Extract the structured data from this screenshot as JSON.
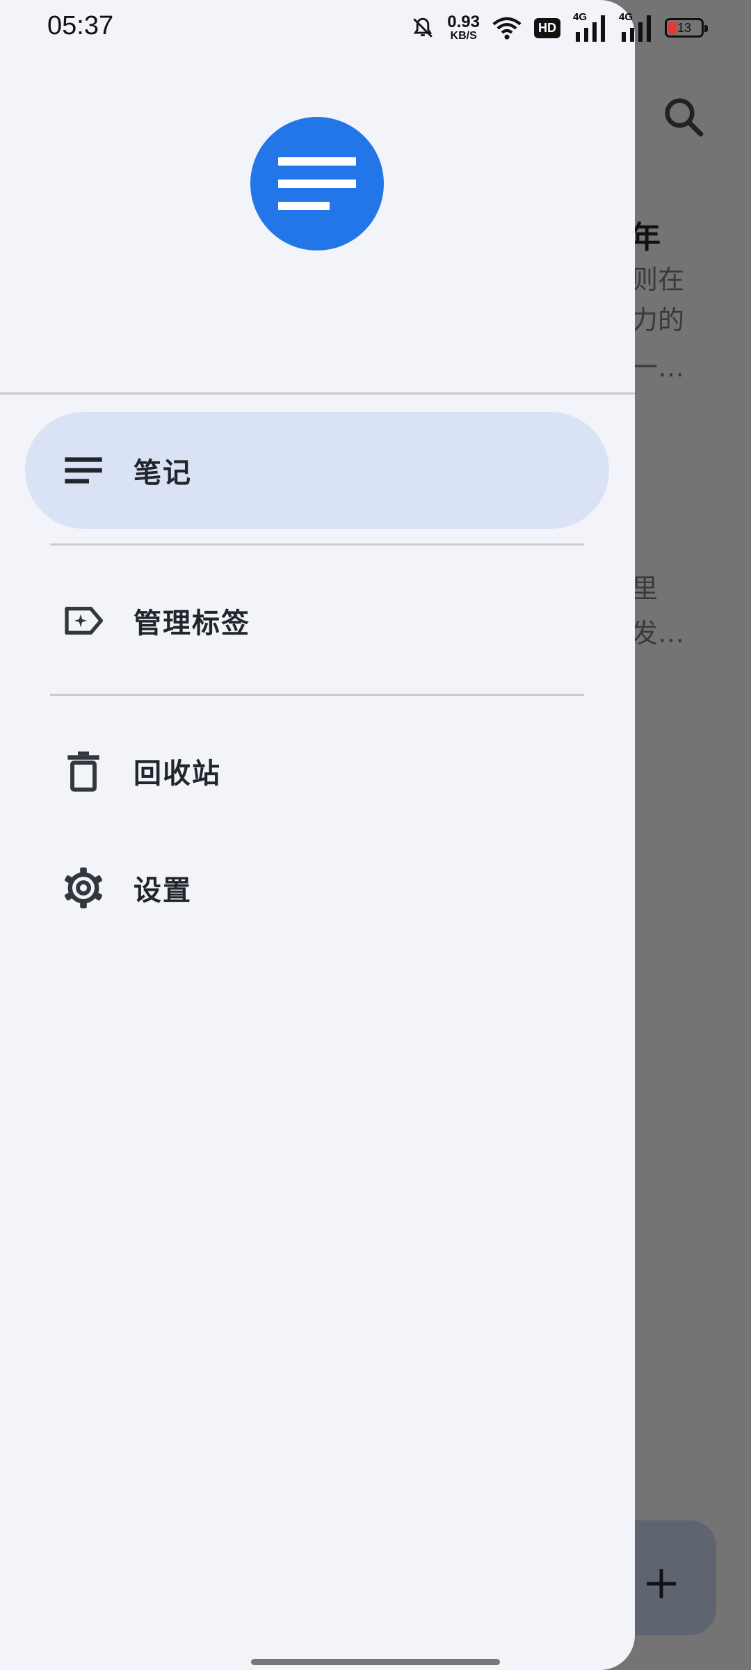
{
  "status_bar": {
    "time": "05:37",
    "net_speed_value": "0.93",
    "net_speed_unit": "KB/S",
    "hd_label": "HD",
    "network_1": "4G",
    "network_2": "4G",
    "battery_level": "13",
    "icons": [
      "bell-off-icon",
      "wifi-icon",
      "signal-icon",
      "battery-icon"
    ]
  },
  "background_screen": {
    "title_fragment": "年",
    "snippet_lines": [
      "则在",
      "力的",
      "一…",
      "里",
      "发…"
    ],
    "icons": [
      "search-icon",
      "plus-icon"
    ]
  },
  "drawer": {
    "logo_icon": "notes-logo-icon",
    "items": [
      {
        "label": "笔记",
        "icon": "notes-list-icon",
        "active": true
      },
      {
        "label": "管理标签",
        "icon": "label-icon",
        "active": false
      },
      {
        "label": "回收站",
        "icon": "trash-icon",
        "active": false
      },
      {
        "label": "设置",
        "icon": "gear-icon",
        "active": false
      }
    ]
  },
  "colors": {
    "accent": "#2276e8",
    "active_item_bg": "#dae2f6",
    "drawer_bg": "#f3f4f9",
    "scrim": "#747474"
  }
}
